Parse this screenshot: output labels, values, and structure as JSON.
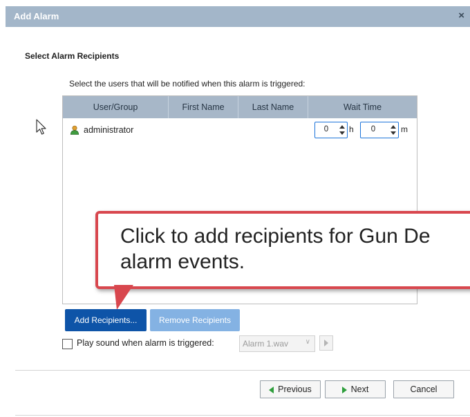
{
  "dialog": {
    "title": "Add Alarm",
    "close_glyph": "×"
  },
  "section_heading": "Select Alarm Recipients",
  "instruction": "Select the users that will be notified when this alarm is triggered:",
  "table": {
    "columns": [
      "User/Group",
      "First Name",
      "Last Name",
      "Wait Time"
    ],
    "rows": [
      {
        "user": "administrator",
        "first_name": "",
        "last_name": "",
        "wait_hours": "0",
        "wait_hours_unit": "h",
        "wait_minutes": "0",
        "wait_minutes_unit": "m",
        "icon": "user-icon"
      }
    ]
  },
  "callout": {
    "text": "Click to add recipients for Gun De\nalarm events."
  },
  "buttons": {
    "add_recipients": "Add Recipients...",
    "remove_recipients": "Remove Recipients",
    "previous": "Previous",
    "next": "Next",
    "cancel": "Cancel"
  },
  "sound": {
    "checkbox_label": "Play sound when alarm is triggered:",
    "checked": false,
    "selected_file": "Alarm 1.wav"
  },
  "colors": {
    "title_bar": "#a3b6c9",
    "table_header": "#a7b7c8",
    "primary_button": "#0e54a8",
    "disabled_button": "#84b2e3",
    "callout_border": "#d8474e",
    "spinner_focus": "#1a73d9",
    "nav_arrow": "#2e9e3c"
  }
}
